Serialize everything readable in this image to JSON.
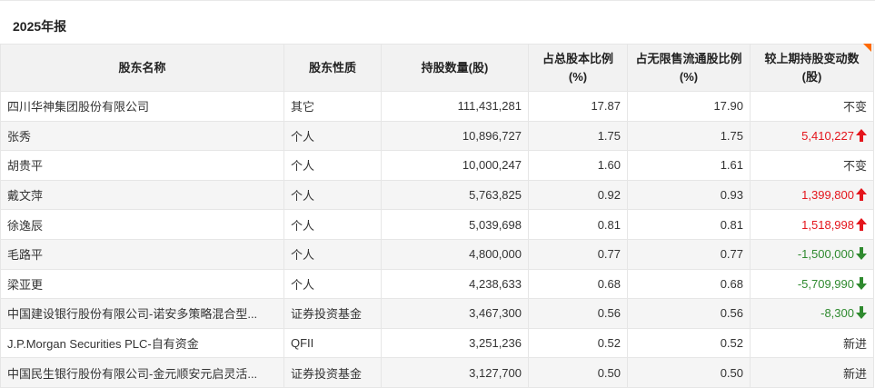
{
  "section": {
    "title": "2025年报"
  },
  "table": {
    "headers": [
      "股东名称",
      "股东性质",
      "持股数量(股)",
      "占总股本比例(%)",
      "占无限售流通股比例(%)",
      "较上期持股变动数(股)"
    ],
    "rows": [
      {
        "name": "四川华神集团股份有限公司",
        "type": "其它",
        "shares": "111,431,281",
        "pct_total": "17.87",
        "pct_float": "17.90",
        "change": "不变",
        "dir": "same"
      },
      {
        "name": "张秀",
        "type": "个人",
        "shares": "10,896,727",
        "pct_total": "1.75",
        "pct_float": "1.75",
        "change": "5,410,227",
        "dir": "up"
      },
      {
        "name": "胡贵平",
        "type": "个人",
        "shares": "10,000,247",
        "pct_total": "1.60",
        "pct_float": "1.61",
        "change": "不变",
        "dir": "same"
      },
      {
        "name": "戴文萍",
        "type": "个人",
        "shares": "5,763,825",
        "pct_total": "0.92",
        "pct_float": "0.93",
        "change": "1,399,800",
        "dir": "up"
      },
      {
        "name": "徐逸辰",
        "type": "个人",
        "shares": "5,039,698",
        "pct_total": "0.81",
        "pct_float": "0.81",
        "change": "1,518,998",
        "dir": "up"
      },
      {
        "name": "毛路平",
        "type": "个人",
        "shares": "4,800,000",
        "pct_total": "0.77",
        "pct_float": "0.77",
        "change": "-1,500,000",
        "dir": "down"
      },
      {
        "name": "梁亚更",
        "type": "个人",
        "shares": "4,238,633",
        "pct_total": "0.68",
        "pct_float": "0.68",
        "change": "-5,709,990",
        "dir": "down"
      },
      {
        "name": "中国建设银行股份有限公司-诺安多策略混合型...",
        "type": "证券投资基金",
        "shares": "3,467,300",
        "pct_total": "0.56",
        "pct_float": "0.56",
        "change": "-8,300",
        "dir": "down"
      },
      {
        "name": "J.P.Morgan Securities PLC-自有资金",
        "type": "QFII",
        "shares": "3,251,236",
        "pct_total": "0.52",
        "pct_float": "0.52",
        "change": "新进",
        "dir": "same"
      },
      {
        "name": "中国民生银行股份有限公司-金元顺安元启灵活...",
        "type": "证券投资基金",
        "shares": "3,127,700",
        "pct_total": "0.50",
        "pct_float": "0.50",
        "change": "新进",
        "dir": "same"
      }
    ]
  },
  "colors": {
    "up": "#e4151c",
    "down": "#2f8a2f",
    "header_bg": "#f2f2f2",
    "alt_row_bg": "#f5f5f5",
    "corner_accent": "#ff6a00"
  }
}
